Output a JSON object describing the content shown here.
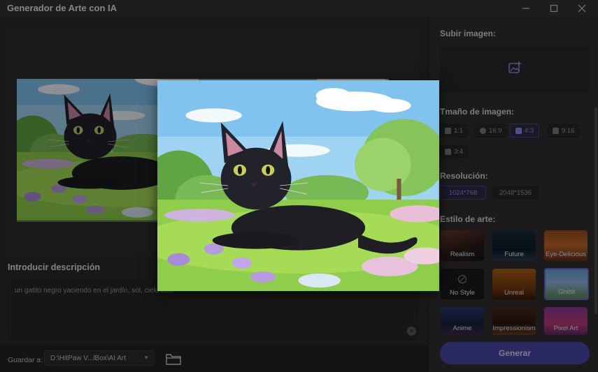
{
  "window": {
    "title": "Generador de Arte con IA",
    "controls": [
      "minimize-icon",
      "maximize-icon",
      "close-icon"
    ]
  },
  "description": {
    "label": "Introducir descripción",
    "value": "un gatito negro yaciendo en el jardín, sol, cielo azul",
    "clear_icon": "clear-icon"
  },
  "save": {
    "label": "Guardar a:",
    "path": "D:\\HitPaw V...lBox\\AI Art",
    "folder_icon": "folder-icon"
  },
  "sidebar": {
    "upload_label": "Subir imagen:",
    "upload_icon": "image-add-icon",
    "size_label": "Tmaño de imagen:",
    "sizes": [
      {
        "label": "1:1",
        "selected": false
      },
      {
        "label": "16:9",
        "selected": false
      },
      {
        "label": "4:3",
        "selected": true
      },
      {
        "label": "9:16",
        "selected": false
      },
      {
        "label": "3:4",
        "selected": false
      }
    ],
    "resolution_label": "Resolución:",
    "resolutions": [
      {
        "label": "1024*768",
        "selected": true
      },
      {
        "label": "2048*1536",
        "selected": false
      }
    ],
    "style_label": "Estilo de arte:",
    "styles": [
      {
        "label": "Realism",
        "selected": false
      },
      {
        "label": "Future",
        "selected": false
      },
      {
        "label": "Eye-Delicious",
        "selected": false
      },
      {
        "label": "No Style",
        "selected": false
      },
      {
        "label": "Unreal",
        "selected": false
      },
      {
        "label": "Ghibli",
        "selected": true
      },
      {
        "label": "Anime",
        "selected": false
      },
      {
        "label": "Impressionism",
        "selected": false
      },
      {
        "label": "Pixel Art",
        "selected": false
      }
    ],
    "generate_label": "Generar"
  },
  "preview": {
    "subject": "black kitten lying in a garden under a blue sky"
  },
  "colors": {
    "accent": "#4b47a8",
    "accent_text": "#8f8ae6",
    "background": "#2b2b2b",
    "panel": "#2f2f2f"
  }
}
